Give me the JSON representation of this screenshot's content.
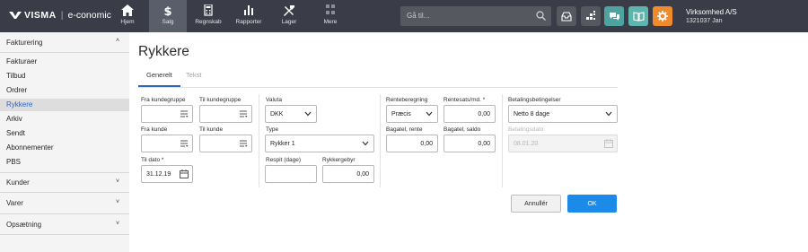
{
  "app": {
    "logo_brand": "VISMA",
    "logo_product": "e-conomic"
  },
  "nav": [
    {
      "label": "Hjem",
      "icon": "home-icon"
    },
    {
      "label": "Salg",
      "icon": "dollar-icon"
    },
    {
      "label": "Regnskab",
      "icon": "calculator-icon"
    },
    {
      "label": "Rapporter",
      "icon": "bar-chart-icon"
    },
    {
      "label": "Lager",
      "icon": "tools-icon"
    },
    {
      "label": "Mere",
      "icon": "grid-icon"
    }
  ],
  "search": {
    "placeholder": "Gå til..."
  },
  "company": {
    "name": "Virksomhed A/S",
    "number": "1321037 Jan"
  },
  "sidebar": {
    "sections": [
      {
        "label": "Fakturering",
        "expanded": true
      },
      {
        "label": "Kunder"
      },
      {
        "label": "Varer"
      },
      {
        "label": "Opsætning"
      }
    ],
    "items": [
      "Fakturaer",
      "Tilbud",
      "Ordrer",
      "Rykkere",
      "Arkiv",
      "Sendt",
      "Abonnementer",
      "PBS"
    ],
    "selected": "Rykkere"
  },
  "page": {
    "title": "Rykkere",
    "tabs": [
      "Generelt",
      "Tekst"
    ]
  },
  "form": {
    "fra_kundegruppe": {
      "label": "Fra kundegruppe",
      "value": ""
    },
    "til_kundegruppe": {
      "label": "Til kundegruppe",
      "value": ""
    },
    "fra_kunde": {
      "label": "Fra kunde",
      "value": ""
    },
    "til_kunde": {
      "label": "Til kunde",
      "value": ""
    },
    "til_dato": {
      "label": "Til dato *",
      "value": "31.12.19"
    },
    "valuta": {
      "label": "Valuta",
      "value": "DKK"
    },
    "type": {
      "label": "Type",
      "value": "Rykker 1"
    },
    "respit": {
      "label": "Respit (dage)",
      "value": ""
    },
    "rykkergebyr": {
      "label": "Rykkergebyr",
      "value": "0,00"
    },
    "renteberegning": {
      "label": "Renteberegning",
      "value": "Præcis"
    },
    "rentesats": {
      "label": "Rentesats/md. *",
      "value": "0,00"
    },
    "bagatel_rente": {
      "label": "Bagatel, rente",
      "value": "0,00"
    },
    "bagatel_saldo": {
      "label": "Bagatel, saldo",
      "value": "0,00"
    },
    "betalingsbetingelser": {
      "label": "Betalingsbetingelser",
      "value": "Netto 8 dage"
    },
    "betalingsdato": {
      "label": "Betalingsdato",
      "value": "08.01.20"
    }
  },
  "buttons": {
    "cancel": "Annullér",
    "ok": "OK"
  },
  "colors": {
    "topbar": "#3a3d48",
    "accent": "#2c64c6",
    "ok_button": "#1c8ae8",
    "settings_button": "#f08b2d",
    "chat_button": "#4ca3a0"
  }
}
